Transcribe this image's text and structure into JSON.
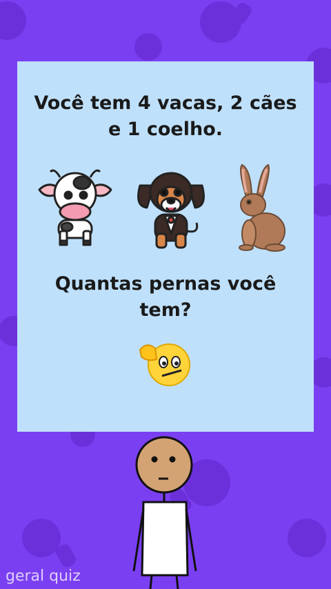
{
  "question": {
    "line1": "Você tem 4 vacas, 2 cães",
    "line2": "e 1 coelho.",
    "prompt_line1": "Quantas pernas você",
    "prompt_line2": "tem?"
  },
  "animals": [
    "cow-icon",
    "dog-icon",
    "rabbit-icon"
  ],
  "emoji": "thinking-face-icon",
  "watermark": "geral quiz",
  "colors": {
    "background": "#7b3ff2",
    "card": "#bfe0fb",
    "text": "#1a1a1a"
  }
}
